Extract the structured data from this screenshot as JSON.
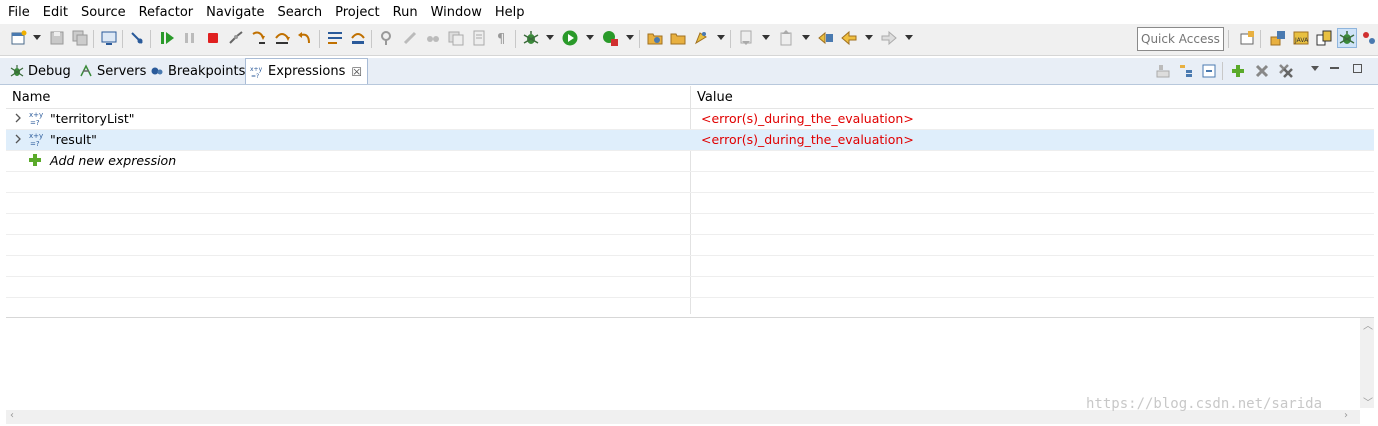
{
  "menu": {
    "items": [
      "File",
      "Edit",
      "Source",
      "Refactor",
      "Navigate",
      "Search",
      "Project",
      "Run",
      "Window",
      "Help"
    ]
  },
  "toolbar": {
    "quick_access": "Quick Access"
  },
  "tabs": [
    {
      "label": "Debug",
      "icon": "bug-icon"
    },
    {
      "label": "Servers",
      "icon": "servers-icon"
    },
    {
      "label": "Breakpoints",
      "icon": "breakpoints-icon"
    },
    {
      "label": "Expressions",
      "icon": "expressions-icon",
      "active": true,
      "close": "☒"
    }
  ],
  "table": {
    "columns": [
      "Name",
      "Value"
    ],
    "rows": [
      {
        "name": "\"territoryList\"",
        "value": "<error(s)_during_the_evaluation>"
      },
      {
        "name": "\"result\"",
        "value": "<error(s)_during_the_evaluation>"
      }
    ],
    "add_label": "Add new expression"
  },
  "watermark": "https://blog.csdn.net/sarida",
  "colors": {
    "error": "#e00000",
    "selection": "#dfeefb",
    "tab_bar": "#e8eef6",
    "run_green": "#2a9a2a",
    "stop_red": "#e02020"
  }
}
